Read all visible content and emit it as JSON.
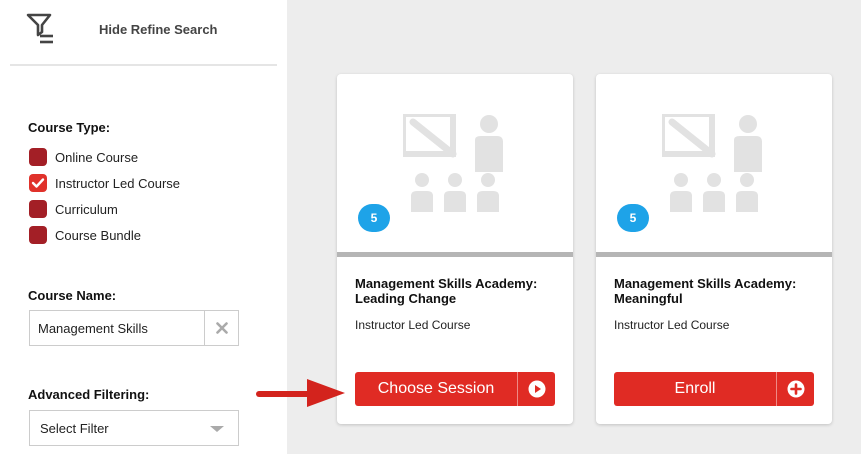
{
  "sidebar": {
    "refine_label": "Hide Refine Search",
    "course_type": {
      "title": "Course Type:",
      "options": [
        {
          "label": "Online Course",
          "checked": false
        },
        {
          "label": "Instructor Led Course",
          "checked": true
        },
        {
          "label": "Curriculum",
          "checked": false
        },
        {
          "label": "Course Bundle",
          "checked": false
        }
      ]
    },
    "course_name": {
      "title": "Course Name:",
      "value": "Management Skills"
    },
    "advanced_filtering": {
      "title": "Advanced Filtering:",
      "selected": "Select Filter"
    }
  },
  "cards": [
    {
      "badge": "5",
      "title": "Management Skills Academy: Leading Change",
      "type": "Instructor Led Course",
      "button_label": "Choose Session",
      "button_icon": "play-circle-icon"
    },
    {
      "badge": "5",
      "title": "Management Skills Academy: Meaningful",
      "type": "Instructor Led Course",
      "button_label": "Enroll",
      "button_icon": "plus-circle-icon"
    }
  ],
  "colors": {
    "brand_red": "#e02b24",
    "checkbox_red": "#a31f26",
    "badge_blue": "#1ea3e8",
    "main_bg": "#ededed"
  }
}
